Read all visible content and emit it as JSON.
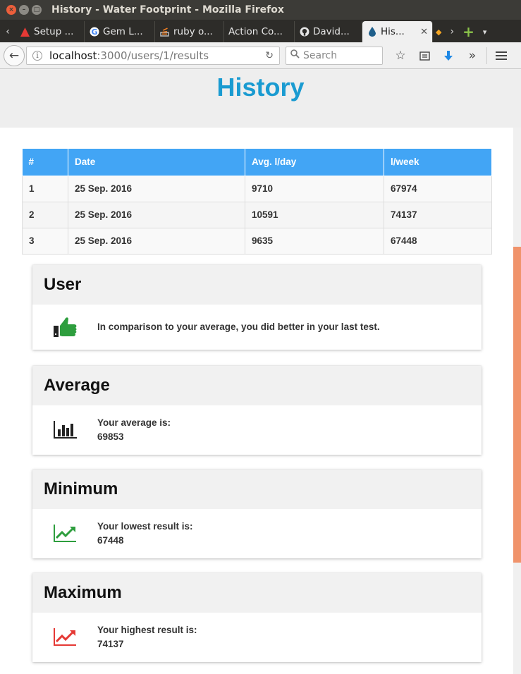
{
  "window": {
    "title": "History - Water Footprint - Mozilla Firefox"
  },
  "tabs": [
    {
      "label": "Setup ...",
      "icon": "red-triangle-icon"
    },
    {
      "label": "Gem L...",
      "icon": "google-icon"
    },
    {
      "label": "ruby o...",
      "icon": "stackoverflow-icon"
    },
    {
      "label": "Action Co...",
      "icon": "none"
    },
    {
      "label": "David...",
      "icon": "github-icon"
    },
    {
      "label": "His...",
      "icon": "water-drop-icon",
      "active": true
    }
  ],
  "navbar": {
    "url_host": "localhost",
    "url_path": ":3000/users/1/results",
    "search_placeholder": "Search"
  },
  "page": {
    "heading": "History",
    "table": {
      "columns": [
        "#",
        "Date",
        "Avg. l/day",
        "l/week"
      ],
      "rows": [
        [
          "1",
          "25 Sep. 2016",
          "9710",
          "67974"
        ],
        [
          "2",
          "25 Sep. 2016",
          "10591",
          "74137"
        ],
        [
          "3",
          "25 Sep. 2016",
          "9635",
          "67448"
        ]
      ]
    },
    "cards": {
      "user": {
        "title": "User",
        "text": "In comparison to your average, you did better in your last test.",
        "icon": "thumbs-up-icon"
      },
      "average": {
        "title": "Average",
        "label": "Your average is:",
        "value": "69853",
        "icon": "bar-chart-icon"
      },
      "minimum": {
        "title": "Minimum",
        "label": "Your lowest result is:",
        "value": "67448",
        "icon": "trend-up-green-icon"
      },
      "maximum": {
        "title": "Maximum",
        "label": "Your highest result is:",
        "value": "74137",
        "icon": "trend-up-red-icon"
      }
    }
  },
  "colors": {
    "heading": "#1a9bd1",
    "table_header": "#42a5f5",
    "thumbs_up": "#2e9e3e",
    "trend_green": "#2e9e3e",
    "trend_red": "#e53935",
    "scroll_accent": "#f0936b"
  }
}
